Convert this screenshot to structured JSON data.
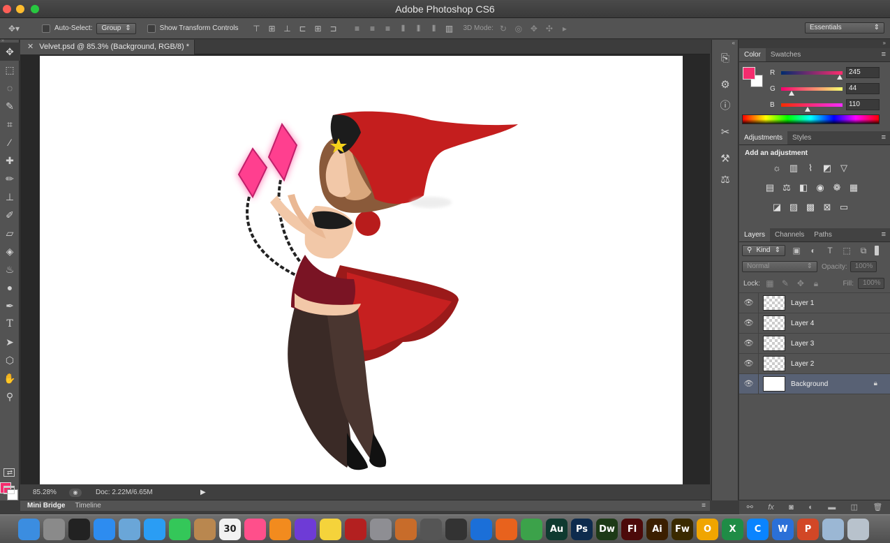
{
  "window": {
    "title": "Adobe Photoshop CS6",
    "traffic_colors": [
      "#fd5f57",
      "#febc2e",
      "#28c840"
    ]
  },
  "options_bar": {
    "auto_select_label": "Auto-Select:",
    "auto_select_value": "Group",
    "show_transform_label": "Show Transform Controls",
    "mode_3d_label": "3D Mode:",
    "workspace": "Essentials"
  },
  "tools": [
    "move-icon",
    "marquee-icon",
    "lasso-icon",
    "quick-select-icon",
    "crop-icon",
    "eyedropper-icon",
    "healing-icon",
    "brush-icon",
    "stamp-icon",
    "history-brush-icon",
    "eraser-icon",
    "paint-bucket-icon",
    "blur-icon",
    "dodge-icon",
    "pen-icon",
    "type-icon",
    "path-select-icon",
    "shape-icon",
    "hand-icon",
    "zoom-icon"
  ],
  "document": {
    "tab_title": "Velvet.psd @ 85.3% (Background, RGB/8) *",
    "zoom": "85.28%",
    "doc_info": "Doc: 2.22M/6.65M"
  },
  "bottom_panel": {
    "tabs": [
      "Mini Bridge",
      "Timeline"
    ]
  },
  "color_panel": {
    "tabs": [
      "Color",
      "Swatches"
    ],
    "foreground": "#f52c6e",
    "background": "#ffffff",
    "channels": [
      {
        "label": "R",
        "value": "245",
        "fraction": 0.96,
        "gradient": "linear-gradient(90deg,#002c6e,#ff2c6e)"
      },
      {
        "label": "G",
        "value": "44",
        "fraction": 0.17,
        "gradient": "linear-gradient(90deg,#f5006e,#f5ff6e)"
      },
      {
        "label": "B",
        "value": "110",
        "fraction": 0.43,
        "gradient": "linear-gradient(90deg,#f52c00,#f52cff)"
      }
    ]
  },
  "adjustments_panel": {
    "tabs": [
      "Adjustments",
      "Styles"
    ],
    "title": "Add an adjustment"
  },
  "layers_panel": {
    "tabs": [
      "Layers",
      "Channels",
      "Paths"
    ],
    "filter_kind": "Kind",
    "blend_mode": "Normal",
    "opacity_label": "Opacity:",
    "opacity_value": "100%",
    "lock_label": "Lock:",
    "fill_label": "Fill:",
    "fill_value": "100%",
    "layers": [
      {
        "name": "Layer 1",
        "selected": false,
        "locked": false
      },
      {
        "name": "Layer 4",
        "selected": false,
        "locked": false
      },
      {
        "name": "Layer 3",
        "selected": false,
        "locked": false
      },
      {
        "name": "Layer 2",
        "selected": false,
        "locked": false
      },
      {
        "name": "Background",
        "selected": true,
        "locked": true
      }
    ]
  },
  "dock": {
    "apps": [
      {
        "name": "finder-icon",
        "label": "",
        "color": "#3b8de0"
      },
      {
        "name": "launchpad-icon",
        "label": "",
        "color": "#8a8a8a"
      },
      {
        "name": "activity-icon",
        "label": "",
        "color": "#222"
      },
      {
        "name": "app-store-icon",
        "label": "",
        "color": "#2d8cf0"
      },
      {
        "name": "preview-icon",
        "label": "",
        "color": "#6aa6d8"
      },
      {
        "name": "safari-icon",
        "label": "",
        "color": "#2a9df4"
      },
      {
        "name": "facetime-icon",
        "label": "",
        "color": "#34c759"
      },
      {
        "name": "contacts-icon",
        "label": "",
        "color": "#b9874f"
      },
      {
        "name": "calendar-icon",
        "label": "30",
        "color": "#f2f2f2"
      },
      {
        "name": "itunes-icon",
        "label": "",
        "color": "#ff4f8b"
      },
      {
        "name": "ibooks-icon",
        "label": "",
        "color": "#f28b1e"
      },
      {
        "name": "imovie-icon",
        "label": "",
        "color": "#6e3bd6"
      },
      {
        "name": "photos-icon",
        "label": "",
        "color": "#f5d33b"
      },
      {
        "name": "photobooth-icon",
        "label": "",
        "color": "#b32020"
      },
      {
        "name": "system-prefs-icon",
        "label": "",
        "color": "#8e8e93"
      },
      {
        "name": "garageband-icon",
        "label": "",
        "color": "#c86c2a"
      },
      {
        "name": "utility-icon",
        "label": "",
        "color": "#555"
      },
      {
        "name": "guitarpro-icon",
        "label": "",
        "color": "#333"
      },
      {
        "name": "quicktime-icon",
        "label": "",
        "color": "#1b6fd8"
      },
      {
        "name": "firefox-icon",
        "label": "",
        "color": "#e8621d"
      },
      {
        "name": "chrome-icon",
        "label": "",
        "color": "#3ca24a"
      },
      {
        "name": "audition-icon",
        "label": "Au",
        "color": "#0f3a30"
      },
      {
        "name": "photoshop-icon",
        "label": "Ps",
        "color": "#0e2b4d"
      },
      {
        "name": "dreamweaver-icon",
        "label": "Dw",
        "color": "#1d3a17"
      },
      {
        "name": "flash-icon",
        "label": "Fl",
        "color": "#4c0a0a"
      },
      {
        "name": "illustrator-icon",
        "label": "Ai",
        "color": "#3b1f00"
      },
      {
        "name": "fireworks-icon",
        "label": "Fw",
        "color": "#3a2a00"
      },
      {
        "name": "office-o-icon",
        "label": "O",
        "color": "#f0a500"
      },
      {
        "name": "excel-icon",
        "label": "X",
        "color": "#1f8c46"
      },
      {
        "name": "lync-icon",
        "label": "C",
        "color": "#0a84ff"
      },
      {
        "name": "word-icon",
        "label": "W",
        "color": "#2b70d8"
      },
      {
        "name": "powerpoint-icon",
        "label": "P",
        "color": "#d24726"
      },
      {
        "name": "preview-docs-icon",
        "label": "",
        "color": "#9bb7d4"
      },
      {
        "name": "trash-icon",
        "label": "",
        "color": "#b8c2cc"
      }
    ]
  }
}
